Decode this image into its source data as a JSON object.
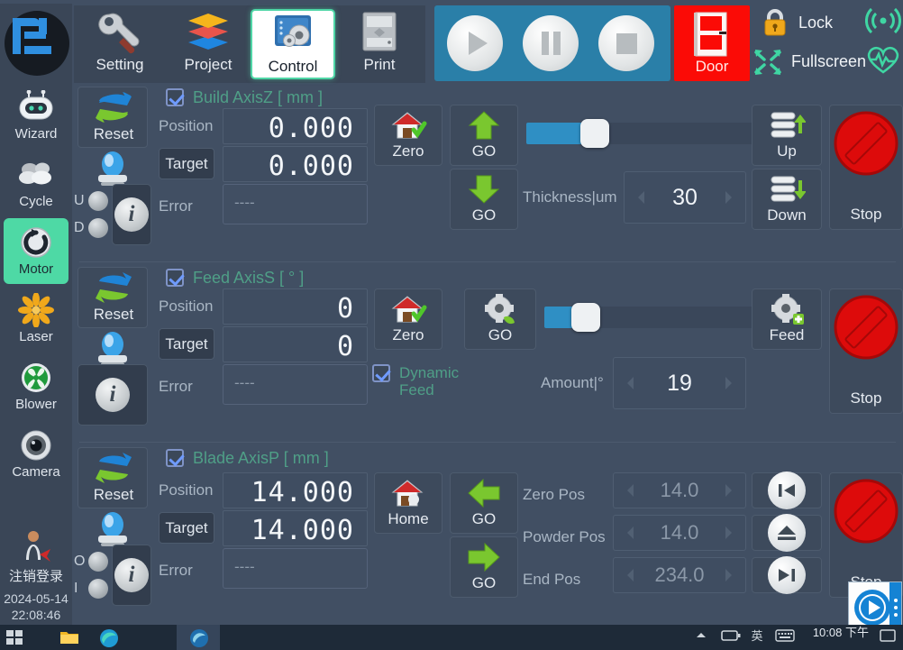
{
  "header": {
    "nav": [
      {
        "label": "Setting",
        "icon": "wrench-icon",
        "active": false
      },
      {
        "label": "Project",
        "icon": "layers-icon",
        "active": false
      },
      {
        "label": "Control",
        "icon": "control-gear-icon",
        "active": true
      },
      {
        "label": "Print",
        "icon": "printer-icon",
        "active": false
      }
    ],
    "transport": [
      {
        "name": "play",
        "label": "Play"
      },
      {
        "name": "pause",
        "label": "Pause"
      },
      {
        "name": "stop",
        "label": "Stop"
      }
    ],
    "door": {
      "label": "Door",
      "color": "#fb0b06"
    },
    "lock": {
      "label": "Lock",
      "icon": "padlock-icon"
    },
    "fullscreen": {
      "label": "Fullscreen",
      "icon": "expand-arrows-icon"
    },
    "signal_icon": "wifi-signal-icon",
    "health_icon": "heartbeat-icon"
  },
  "sidebar": {
    "items": [
      {
        "label": "Wizard",
        "icon": "robot-icon",
        "active": false
      },
      {
        "label": "Cycle",
        "icon": "cloud-icon",
        "active": false
      },
      {
        "label": "Motor",
        "icon": "motor-rotate-icon",
        "active": true
      },
      {
        "label": "Laser",
        "icon": "laser-flower-icon",
        "active": false
      },
      {
        "label": "Blower",
        "icon": "fan-icon",
        "active": false
      },
      {
        "label": "Camera",
        "icon": "camera-icon",
        "active": false
      }
    ],
    "logout": {
      "label": "注销登录",
      "icon": "user-logout-icon"
    },
    "date": "2024-05-14",
    "time": "22:08:46"
  },
  "axes": [
    {
      "id": "build-axis-z",
      "title": "Build AxisZ [ mm ]",
      "checked": true,
      "reset_label": "Reset",
      "position_label": "Position",
      "position_value": "0.000",
      "target_label": "Target",
      "target_value": "0.000",
      "error_label": "Error",
      "error_value": "----",
      "indicators": [
        {
          "label": "U",
          "on": false
        },
        {
          "label": "D",
          "on": false
        }
      ],
      "home_button": {
        "label": "Zero",
        "icon": "home-check-icon"
      },
      "go_buttons": [
        {
          "label": "GO",
          "icon": "arrow-up-icon"
        },
        {
          "label": "GO",
          "icon": "arrow-down-icon"
        }
      ],
      "slider": {
        "percent": 27
      },
      "param_label": "Thickness|um",
      "param_value": "30",
      "jog_buttons": [
        {
          "label": "Up",
          "icon": "stack-up-icon"
        },
        {
          "label": "Down",
          "icon": "stack-down-icon"
        }
      ],
      "stop_label": "Stop"
    },
    {
      "id": "feed-axis-s",
      "title": "Feed AxisS [ ° ]",
      "checked": true,
      "reset_label": "Reset",
      "position_label": "Position",
      "position_value": "0",
      "target_label": "Target",
      "target_value": "0",
      "error_label": "Error",
      "error_value": "----",
      "dynamic_feed": {
        "label_line1": "Dynamic",
        "label_line2": "Feed",
        "checked": true
      },
      "home_button": {
        "label": "Zero",
        "icon": "home-check-icon"
      },
      "go_buttons": [
        {
          "label": "GO",
          "icon": "gear-go-icon"
        }
      ],
      "slider": {
        "percent": 13
      },
      "param_label": "Amount|°",
      "param_value": "19",
      "jog_buttons": [
        {
          "label": "Feed",
          "icon": "gear-plus-icon"
        }
      ],
      "stop_label": "Stop"
    },
    {
      "id": "blade-axis-p",
      "title": "Blade AxisP [ mm ]",
      "checked": true,
      "reset_label": "Reset",
      "position_label": "Position",
      "position_value": "14.000",
      "target_label": "Target",
      "target_value": "14.000",
      "error_label": "Error",
      "error_value": "----",
      "indicators": [
        {
          "label": "O",
          "on": false
        },
        {
          "label": "I",
          "on": false
        }
      ],
      "home_button": {
        "label": "Home",
        "icon": "home-icon"
      },
      "go_buttons": [
        {
          "label": "GO",
          "icon": "arrow-left-icon"
        },
        {
          "label": "GO",
          "icon": "arrow-right-icon"
        }
      ],
      "positions": [
        {
          "label": "Zero Pos",
          "value": "14.0",
          "icon": "skip-back-icon"
        },
        {
          "label": "Powder Pos",
          "value": "14.0",
          "icon": "eject-icon"
        },
        {
          "label": "End Pos",
          "value": "234.0",
          "icon": "skip-forward-icon"
        }
      ],
      "stop_label": "Stop"
    }
  ],
  "taskbar": {
    "clock_time": "10:08",
    "clock_period": "下午"
  },
  "colors": {
    "background": "#414f63",
    "panel": "#3a4657",
    "accent_teal": "#4f9f87",
    "accent_green": "#4ed9a5",
    "slider_blue": "#2f8fc4",
    "danger_red": "#fb0b06",
    "transport_blue": "#2a7fa8"
  }
}
